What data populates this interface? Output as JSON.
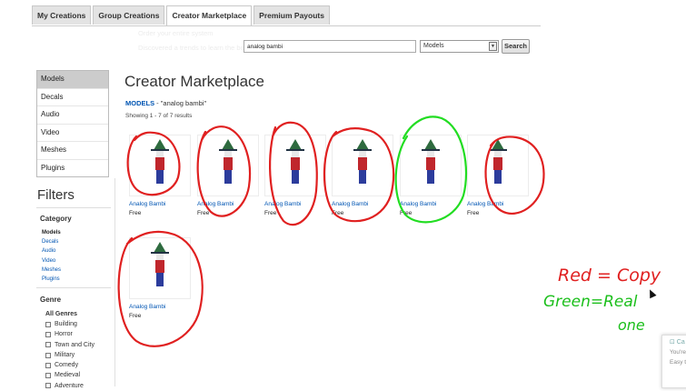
{
  "tabs": [
    "My Creations",
    "Group Creations",
    "Creator Marketplace",
    "Premium Payouts"
  ],
  "ghost": {
    "line1": "Order your entire system",
    "line2": "Discovered a trends to learn the bo"
  },
  "search": {
    "value": "analog bambi",
    "category": "Models",
    "button": "Search"
  },
  "nav": [
    "Models",
    "Decals",
    "Audio",
    "Video",
    "Meshes",
    "Plugins"
  ],
  "filters": {
    "title": "Filters",
    "category_label": "Category",
    "category_links": [
      "Models",
      "Decals",
      "Audio",
      "Video",
      "Meshes",
      "Plugins"
    ],
    "genre_label": "Genre",
    "all_genres": "All Genres",
    "genres": [
      "Building",
      "Horror",
      "Town and City",
      "Military",
      "Comedy",
      "Medieval",
      "Adventure"
    ]
  },
  "main": {
    "title": "Creator Marketplace",
    "crumb_category": "MODELS",
    "crumb_query": " - \"analog bambi\"",
    "showing": "Showing 1 - 7 of 7 results"
  },
  "items": [
    {
      "name": "Analog Bambi",
      "price": "Free"
    },
    {
      "name": "Analog Bambi",
      "price": "Free"
    },
    {
      "name": "Analog Bambi",
      "price": "Free"
    },
    {
      "name": "Analog Bambi",
      "price": "Free"
    },
    {
      "name": "Analog Bambi",
      "price": "Free"
    },
    {
      "name": "Analog Bambi",
      "price": "Free"
    },
    {
      "name": "Analog Bambi",
      "price": "Free"
    }
  ],
  "annotations": {
    "red_note": "Red = Copy",
    "green_note_1": "Green=Real",
    "green_note_2": "one"
  },
  "popup": {
    "icon": "⊡ Ca",
    "line1": "You're",
    "line2": "Easy t"
  },
  "colors": {
    "red": "#e02020",
    "green": "#1bbf1b",
    "link": "#0055b3"
  }
}
